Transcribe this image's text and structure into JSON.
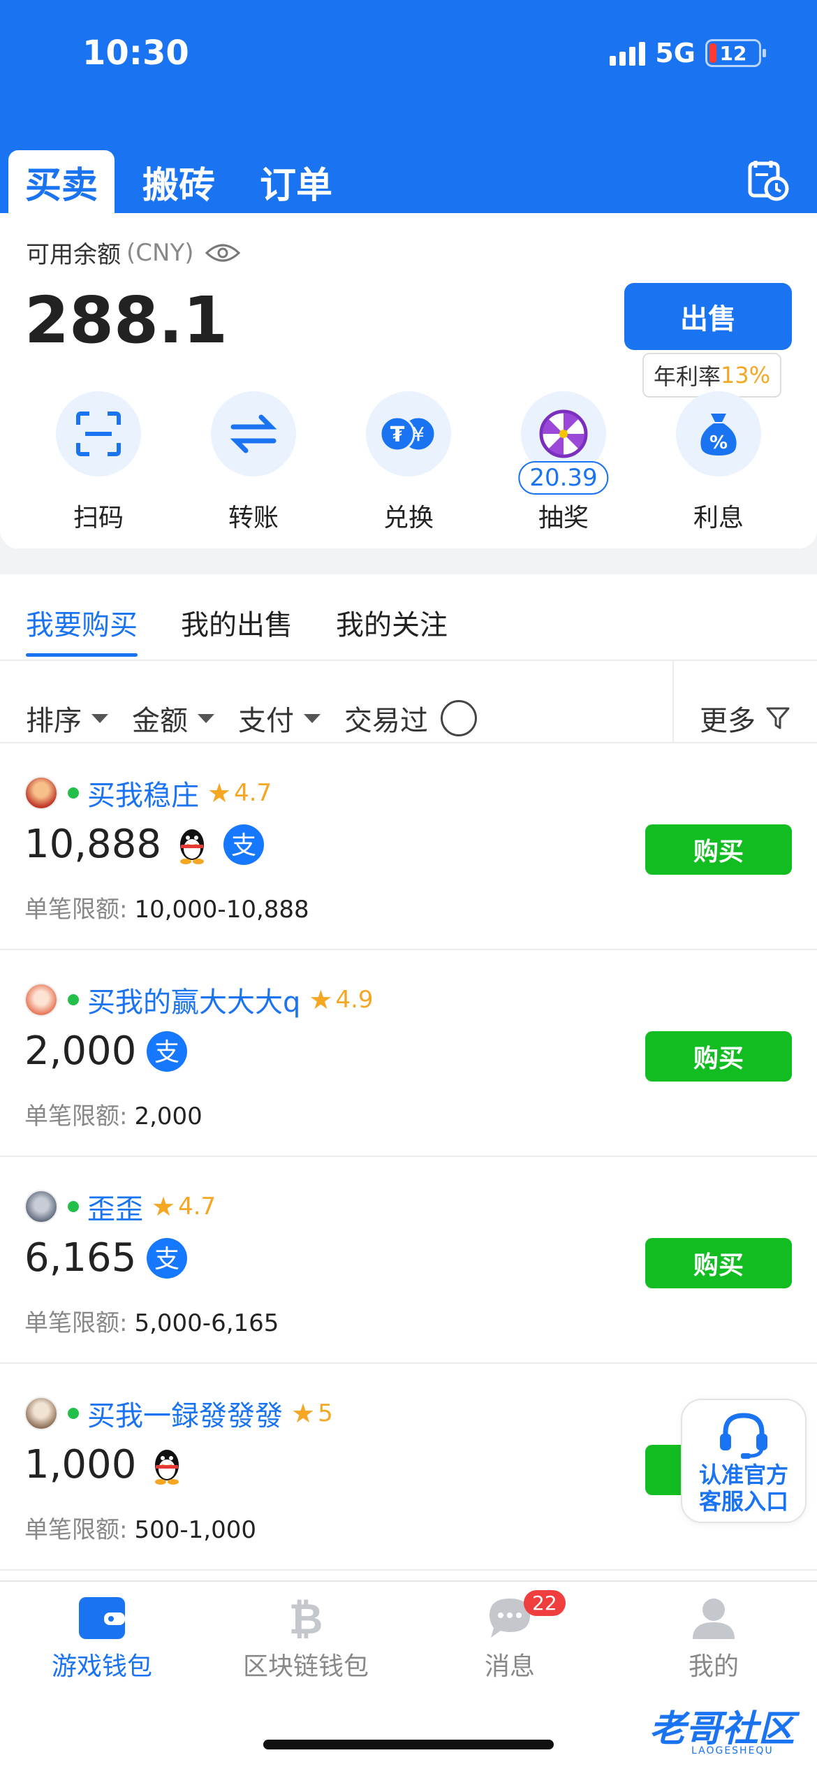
{
  "status_bar": {
    "time": "10:30",
    "network": "5G",
    "battery": "12"
  },
  "top_tabs": [
    {
      "label": "买卖",
      "active": true
    },
    {
      "label": "搬砖",
      "active": false
    },
    {
      "label": "订单",
      "active": false
    }
  ],
  "balance": {
    "label": "可用余额",
    "currency": "(CNY)",
    "amount": "288.1",
    "sell_label": "出售",
    "apr_label": "年利率",
    "apr_value": "13%"
  },
  "actions": [
    {
      "label": "扫码",
      "icon": "scan-icon"
    },
    {
      "label": "转账",
      "icon": "transfer-icon"
    },
    {
      "label": "兑换",
      "icon": "exchange-icon"
    },
    {
      "label": "抽奖",
      "icon": "lottery-wheel-icon",
      "badge": "20.39"
    },
    {
      "label": "利息",
      "icon": "money-bag-icon"
    }
  ],
  "market_tabs": [
    {
      "label": "我要购买",
      "active": true
    },
    {
      "label": "我的出售",
      "active": false
    },
    {
      "label": "我的关注",
      "active": false
    }
  ],
  "filters": {
    "sort": "排序",
    "amount": "金额",
    "payment": "支付",
    "traded": "交易过",
    "more": "更多"
  },
  "listings": [
    {
      "name": "买我稳庄",
      "rating": "4.7",
      "price": "10,888",
      "pay_methods": [
        "qq",
        "alipay"
      ],
      "limit_label": "单笔限额:",
      "limit": "10,000-10,888",
      "buy_label": "购买"
    },
    {
      "name": "买我的赢大大大q",
      "rating": "4.9",
      "price": "2,000",
      "pay_methods": [
        "alipay"
      ],
      "limit_label": "单笔限额:",
      "limit": "2,000",
      "buy_label": "购买"
    },
    {
      "name": "歪歪",
      "rating": "4.7",
      "price": "6,165",
      "pay_methods": [
        "alipay"
      ],
      "limit_label": "单笔限额:",
      "limit": "5,000-6,165",
      "buy_label": "购买"
    },
    {
      "name": "买我一録發發發",
      "rating": "5",
      "price": "1,000",
      "pay_methods": [
        "qq"
      ],
      "limit_label": "单笔限额:",
      "limit": "500-1,000",
      "buy_label": "购买"
    }
  ],
  "customer_service": {
    "line1": "认准官方",
    "line2": "客服入口"
  },
  "bottom_nav": [
    {
      "label": "游戏钱包",
      "icon": "wallet-icon",
      "active": true
    },
    {
      "label": "区块链钱包",
      "icon": "bitcoin-icon",
      "active": false
    },
    {
      "label": "消息",
      "icon": "chat-bubble-icon",
      "active": false,
      "badge": "22"
    },
    {
      "label": "我的",
      "icon": "user-icon",
      "active": false
    }
  ],
  "watermark": {
    "title": "老哥社区",
    "subtitle": "LAOGESHEQU"
  },
  "colors": {
    "primary": "#1a73f0",
    "buy": "#12bd21",
    "rating": "#f5a623",
    "badge": "#f03e3e"
  }
}
